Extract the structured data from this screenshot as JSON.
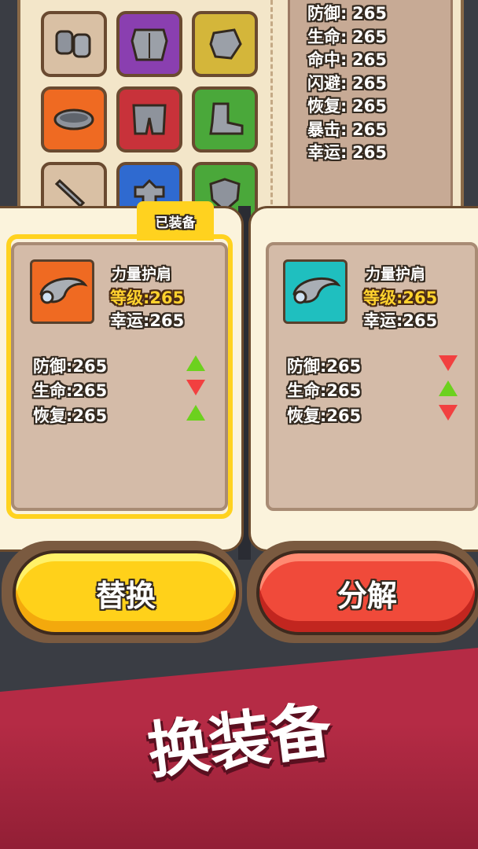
{
  "background_inventory": {
    "slots": [
      {
        "name": "gauntlets-icon",
        "color": "#d9c0a4"
      },
      {
        "name": "chest-armor-icon",
        "color": "#8a3fb0"
      },
      {
        "name": "glove-icon",
        "color": "#d4b63a"
      },
      {
        "name": "belt-icon",
        "color": "#ef6a22"
      },
      {
        "name": "pants-icon",
        "color": "#c8323a"
      },
      {
        "name": "boots-icon",
        "color": "#4aa83a"
      },
      {
        "name": "sword-icon",
        "color": "#d9c0a4"
      },
      {
        "name": "helmet-icon",
        "color": "#2f6ad0"
      },
      {
        "name": "shield-icon",
        "color": "#4aa83a"
      }
    ],
    "stats": [
      {
        "label": "防御:",
        "value": "265"
      },
      {
        "label": "生命:",
        "value": "265"
      },
      {
        "label": "命中:",
        "value": "265"
      },
      {
        "label": "闪避:",
        "value": "265"
      },
      {
        "label": "恢复:",
        "value": "265"
      },
      {
        "label": "暴击:",
        "value": "265"
      },
      {
        "label": "幸运:",
        "value": "265"
      }
    ]
  },
  "left_card": {
    "tag": "已装备",
    "icon": "shoulder-pad-icon",
    "icon_bg": "#ef6a22",
    "name": "力量护肩",
    "level_label": "等级:",
    "level_value": "265",
    "luck_label": "幸运:",
    "luck_value": "265",
    "stats": [
      {
        "label": "防御:",
        "value": "265",
        "trend": "up"
      },
      {
        "label": "生命:",
        "value": "265",
        "trend": "down"
      },
      {
        "label": "恢复:",
        "value": "265",
        "trend": "up"
      }
    ]
  },
  "right_card": {
    "icon": "shoulder-pad-icon",
    "icon_bg": "#1fbfbf",
    "name": "力量护肩",
    "level_label": "等级:",
    "level_value": "265",
    "luck_label": "幸运:",
    "luck_value": "265",
    "stats": [
      {
        "label": "防御:",
        "value": "265",
        "trend": "down"
      },
      {
        "label": "生命:",
        "value": "265",
        "trend": "up"
      },
      {
        "label": "恢复:",
        "value": "265",
        "trend": "down"
      }
    ]
  },
  "buttons": {
    "replace_label": "替换",
    "salvage_label": "分解"
  },
  "banner": {
    "title": "换装备"
  }
}
